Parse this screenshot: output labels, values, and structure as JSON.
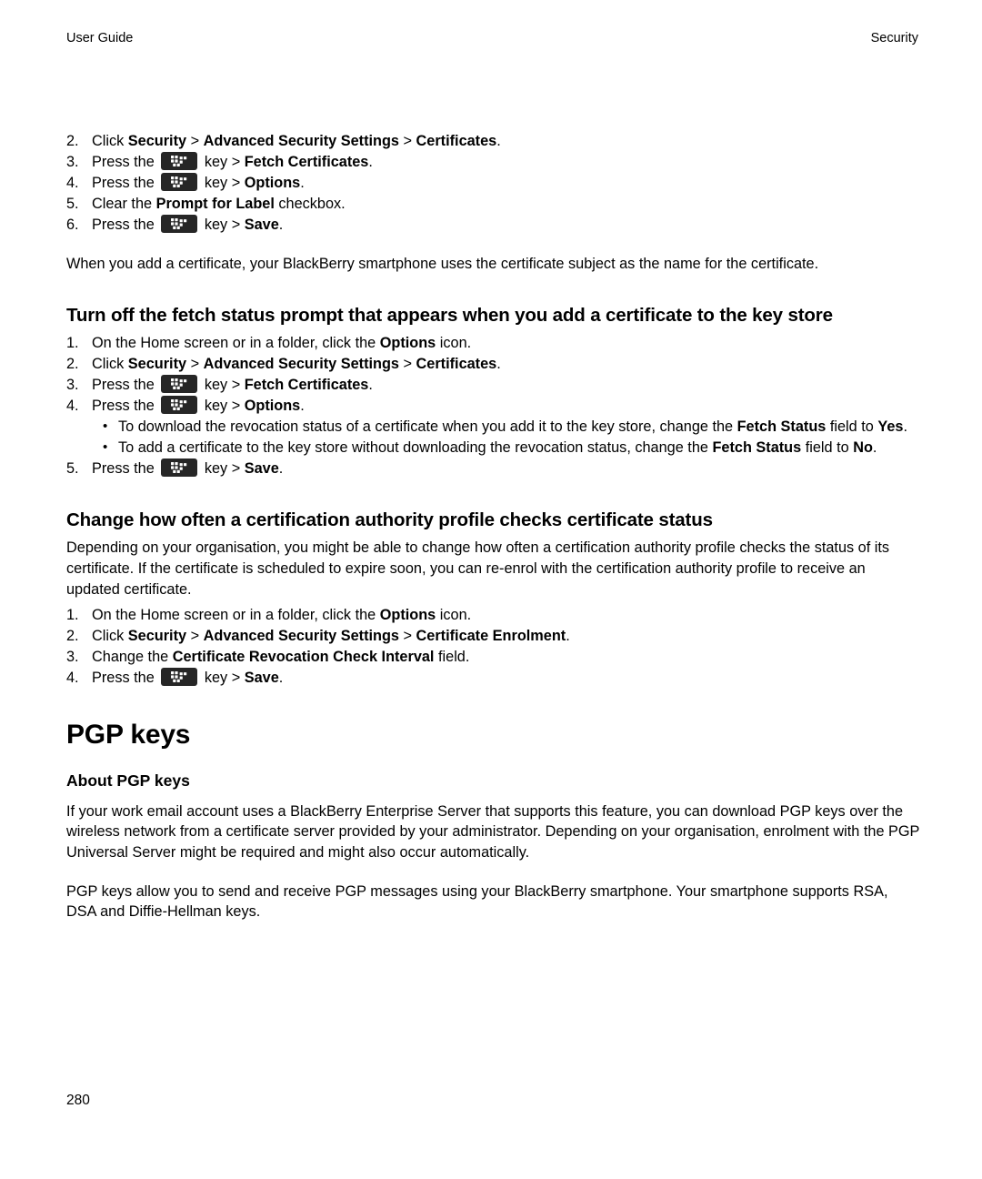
{
  "page": {
    "running_head_left": "User Guide",
    "running_head_right": "Security",
    "folio": "280"
  },
  "icons": {
    "menu_key": "blackberry-menu-key-icon"
  },
  "sections": [
    {
      "id": "top-procedure-continued",
      "steps": [
        {
          "num": "2.",
          "parts": [
            {
              "t": "Click ",
              "b": false
            },
            {
              "t": "Security",
              "b": true
            },
            {
              "t": " > ",
              "b": false
            },
            {
              "t": "Advanced Security Settings",
              "b": true
            },
            {
              "t": " > ",
              "b": false
            },
            {
              "t": "Certificates",
              "b": true
            },
            {
              "t": ".",
              "b": false
            }
          ]
        },
        {
          "num": "3.",
          "parts": [
            {
              "t": "Press the ",
              "b": false
            },
            {
              "icon": "menu-key"
            },
            {
              "t": " key > ",
              "b": false
            },
            {
              "t": "Fetch Certificates",
              "b": true
            },
            {
              "t": ".",
              "b": false
            }
          ]
        },
        {
          "num": "4.",
          "parts": [
            {
              "t": "Press the ",
              "b": false
            },
            {
              "icon": "menu-key"
            },
            {
              "t": " key > ",
              "b": false
            },
            {
              "t": "Options",
              "b": true
            },
            {
              "t": ".",
              "b": false
            }
          ]
        },
        {
          "num": "5.",
          "parts": [
            {
              "t": "Clear the ",
              "b": false
            },
            {
              "t": "Prompt for Label",
              "b": true
            },
            {
              "t": " checkbox.",
              "b": false
            }
          ]
        },
        {
          "num": "6.",
          "parts": [
            {
              "t": "Press the ",
              "b": false
            },
            {
              "icon": "menu-key"
            },
            {
              "t": " key > ",
              "b": false
            },
            {
              "t": "Save",
              "b": true
            },
            {
              "t": ".",
              "b": false
            }
          ]
        }
      ],
      "note": "When you add a certificate, your BlackBerry smartphone uses the certificate subject as the name for the certificate."
    },
    {
      "id": "fetch-status-prompt",
      "heading": "Turn off the fetch status prompt that appears when you add a certificate to the key store",
      "steps_a": [
        {
          "num": "1.",
          "parts": [
            {
              "t": "On the Home screen or in a folder, click the ",
              "b": false
            },
            {
              "t": "Options",
              "b": true
            },
            {
              "t": " icon.",
              "b": false
            }
          ]
        },
        {
          "num": "2.",
          "parts": [
            {
              "t": "Click ",
              "b": false
            },
            {
              "t": "Security",
              "b": true
            },
            {
              "t": " > ",
              "b": false
            },
            {
              "t": "Advanced Security Settings",
              "b": true
            },
            {
              "t": " > ",
              "b": false
            },
            {
              "t": "Certificates",
              "b": true
            },
            {
              "t": ".",
              "b": false
            }
          ]
        },
        {
          "num": "3.",
          "parts": [
            {
              "t": "Press the ",
              "b": false
            },
            {
              "icon": "menu-key"
            },
            {
              "t": " key > ",
              "b": false
            },
            {
              "t": "Fetch Certificates",
              "b": true
            },
            {
              "t": ".",
              "b": false
            }
          ]
        },
        {
          "num": "4.",
          "parts": [
            {
              "t": "Press the ",
              "b": false
            },
            {
              "icon": "menu-key"
            },
            {
              "t": " key > ",
              "b": false
            },
            {
              "t": "Options",
              "b": true
            },
            {
              "t": ".",
              "b": false
            }
          ]
        }
      ],
      "bullets": [
        {
          "parts": [
            {
              "t": "To download the revocation status of a certificate when you add it to the key store, change the ",
              "b": false
            },
            {
              "t": "Fetch Status",
              "b": true
            },
            {
              "t": " field to ",
              "b": false
            },
            {
              "t": "Yes",
              "b": true
            },
            {
              "t": ".",
              "b": false
            }
          ]
        },
        {
          "parts": [
            {
              "t": "To add a certificate to the key store without downloading the revocation status, change the ",
              "b": false
            },
            {
              "t": "Fetch Status",
              "b": true
            },
            {
              "t": " field to ",
              "b": false
            },
            {
              "t": "No",
              "b": true
            },
            {
              "t": ".",
              "b": false
            }
          ]
        }
      ],
      "steps_b": [
        {
          "num": "5.",
          "parts": [
            {
              "t": "Press the ",
              "b": false
            },
            {
              "icon": "menu-key"
            },
            {
              "t": " key > ",
              "b": false
            },
            {
              "t": "Save",
              "b": true
            },
            {
              "t": ".",
              "b": false
            }
          ]
        }
      ]
    },
    {
      "id": "ca-profile-check-interval",
      "heading": "Change how often a certification authority profile checks certificate status",
      "intro": "Depending on your organisation, you might be able to change how often a certification authority profile checks the status of its certificate. If the certificate is scheduled to expire soon, you can re-enrol with the certification authority profile to receive an updated certificate.",
      "steps": [
        {
          "num": "1.",
          "parts": [
            {
              "t": "On the Home screen or in a folder, click the ",
              "b": false
            },
            {
              "t": "Options",
              "b": true
            },
            {
              "t": " icon.",
              "b": false
            }
          ]
        },
        {
          "num": "2.",
          "parts": [
            {
              "t": "Click ",
              "b": false
            },
            {
              "t": "Security",
              "b": true
            },
            {
              "t": " > ",
              "b": false
            },
            {
              "t": "Advanced Security Settings",
              "b": true
            },
            {
              "t": " > ",
              "b": false
            },
            {
              "t": "Certificate Enrolment",
              "b": true
            },
            {
              "t": ".",
              "b": false
            }
          ]
        },
        {
          "num": "3.",
          "parts": [
            {
              "t": "Change the ",
              "b": false
            },
            {
              "t": "Certificate Revocation Check Interval",
              "b": true
            },
            {
              "t": " field.",
              "b": false
            }
          ]
        },
        {
          "num": "4.",
          "parts": [
            {
              "t": "Press the ",
              "b": false
            },
            {
              "icon": "menu-key"
            },
            {
              "t": " key > ",
              "b": false
            },
            {
              "t": "Save",
              "b": true
            },
            {
              "t": ".",
              "b": false
            }
          ]
        }
      ]
    },
    {
      "id": "pgp-keys",
      "title": "PGP keys",
      "subheading": "About PGP keys",
      "paragraphs": [
        "If your work email account uses a BlackBerry Enterprise Server that supports this feature, you can download PGP keys over the wireless network from a certificate server provided by your administrator. Depending on your organisation, enrolment with the PGP Universal Server might be required and might also occur automatically.",
        "PGP keys allow you to send and receive PGP messages using your BlackBerry smartphone. Your smartphone supports RSA, DSA and Diffie-Hellman keys."
      ]
    }
  ]
}
